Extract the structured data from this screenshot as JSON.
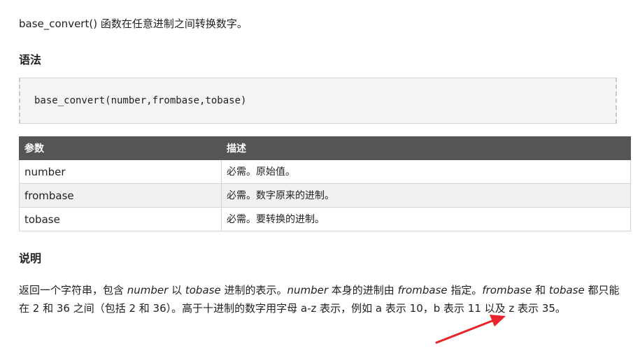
{
  "intro": "base_convert() 函数在任意进制之间转换数字。",
  "syntax": {
    "heading": "语法",
    "code": "base_convert(number,frombase,tobase)"
  },
  "params_table": {
    "headers": [
      "参数",
      "描述"
    ],
    "rows": [
      {
        "param": "number",
        "desc": "必需。原始值。"
      },
      {
        "param": "frombase",
        "desc": "必需。数字原来的进制。"
      },
      {
        "param": "tobase",
        "desc": "必需。要转换的进制。"
      }
    ]
  },
  "description": {
    "heading": "说明",
    "p1": "返回一个字符串，包含 ",
    "number_em": "number",
    "p2": " 以 ",
    "tobase_em": "tobase",
    "p3": " 进制的表示。",
    "number_em2": "number",
    "p4": " 本身的进制由 ",
    "frombase_em": "frombase",
    "p5": " 指定。",
    "frombase_em2": "frombase",
    "p6": " 和 ",
    "tobase_em2": "tobase",
    "p7": " 都只能在 2 和 36 之间（包括 2 和 36）。高于十进制的数字用字母 a-z 表示，例如 a 表示 10，b 表示 11 以及 z 表示 35。"
  },
  "colors": {
    "header_bg": "#555555",
    "alt_row_bg": "#f1f1f1",
    "code_bg": "#f4f4f4",
    "annotation_arrow": "#e8232a"
  }
}
